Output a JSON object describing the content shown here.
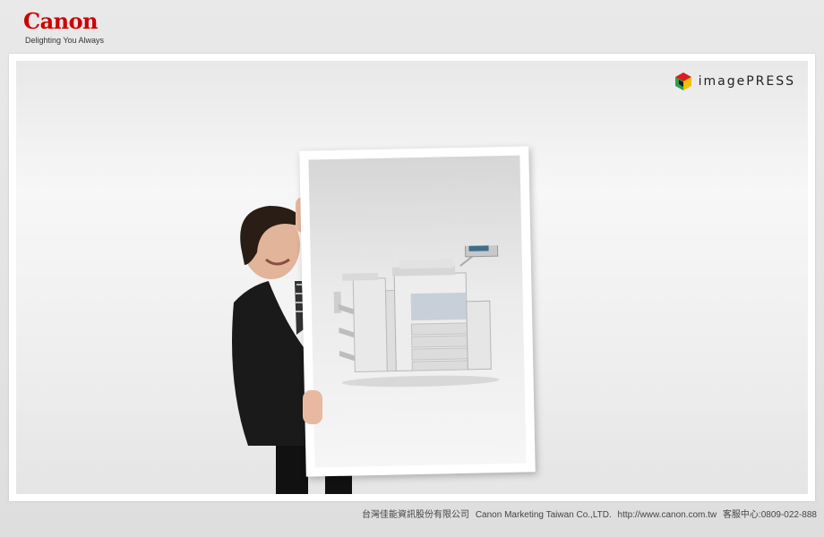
{
  "header": {
    "logo_text": "Canon",
    "tagline": "Delighting You Always"
  },
  "banner": {
    "brand_name": "imagePRESS"
  },
  "footer": {
    "company_zh": "台灣佳能資訊股份有限公司",
    "company_en": "Canon Marketing Taiwan Co.,LTD.",
    "url": "http://www.canon.com.tw",
    "service": "客服中心:0809-022-888"
  },
  "colors": {
    "brand_red": "#cc0000"
  }
}
